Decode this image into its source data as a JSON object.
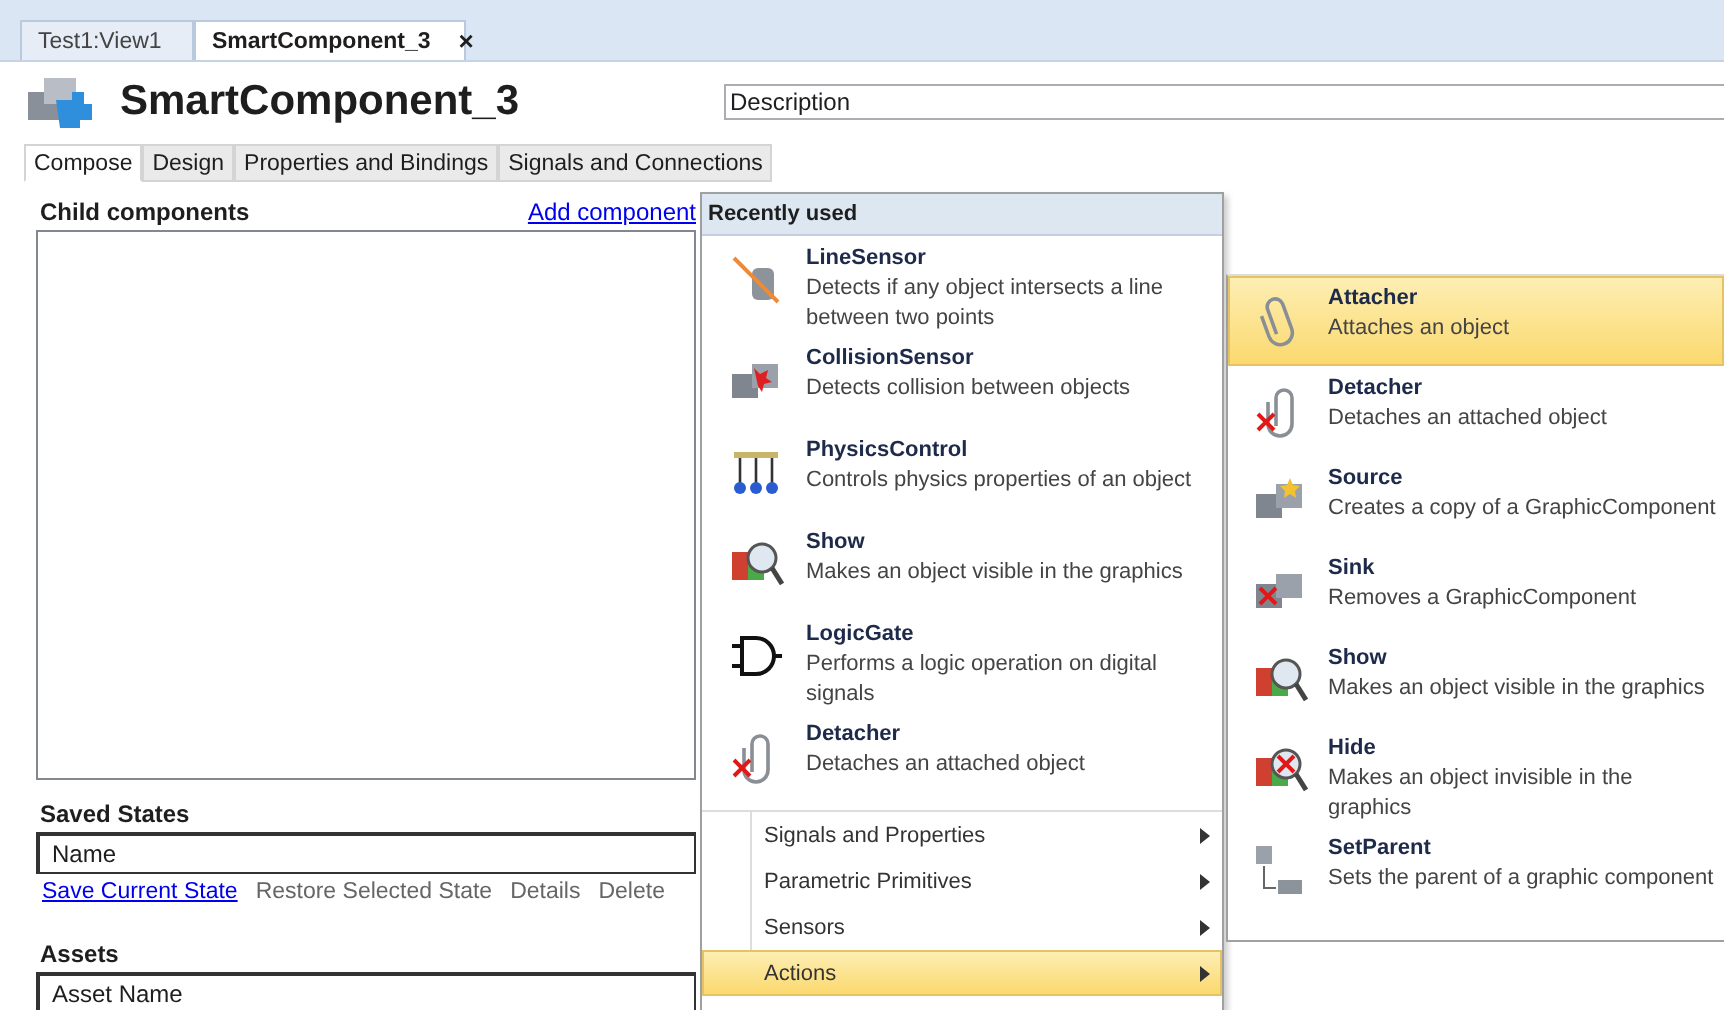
{
  "document_tabs": [
    {
      "label": "Test1:View1",
      "selected": false
    },
    {
      "label": "SmartComponent_3",
      "selected": true,
      "close": "×"
    }
  ],
  "header": {
    "title": "SmartComponent_3",
    "description": {
      "value": "Description"
    }
  },
  "tabs": [
    {
      "label": "Compose",
      "selected": true
    },
    {
      "label": "Design",
      "selected": false
    },
    {
      "label": "Properties and Bindings",
      "selected": false
    },
    {
      "label": "Signals and Connections",
      "selected": false
    }
  ],
  "child_components": {
    "label": "Child components",
    "add_link": "Add component"
  },
  "saved_states": {
    "label": "Saved States",
    "column": "Name",
    "actions": [
      {
        "label": "Save Current State",
        "disabled": false
      },
      {
        "label": "Restore Selected State",
        "disabled": true
      },
      {
        "label": "Details",
        "disabled": true
      },
      {
        "label": "Delete",
        "disabled": true
      }
    ]
  },
  "assets": {
    "label": "Assets",
    "column": "Asset Name"
  },
  "recent_menu": {
    "header": "Recently used",
    "items": [
      {
        "title": "LineSensor",
        "description": "Detects if any object intersects a line\nbetween two points"
      },
      {
        "title": "CollisionSensor",
        "description": "Detects collision between objects"
      },
      {
        "title": "PhysicsControl",
        "description": "Controls physics properties of an object"
      },
      {
        "title": "Show",
        "description": "Makes an object visible in the graphics"
      },
      {
        "title": "LogicGate",
        "description": "Performs a logic operation on digital\nsignals"
      },
      {
        "title": "Detacher",
        "description": "Detaches an attached object"
      }
    ],
    "submenus": [
      {
        "label": "Signals and Properties",
        "selected": false
      },
      {
        "label": "Parametric Primitives",
        "selected": false
      },
      {
        "label": "Sensors",
        "selected": false
      },
      {
        "label": "Actions",
        "selected": true
      }
    ]
  },
  "actions_menu": {
    "items": [
      {
        "title": "Attacher",
        "description": "Attaches an object",
        "selected": true
      },
      {
        "title": "Detacher",
        "description": "Detaches an attached object",
        "selected": false
      },
      {
        "title": "Source",
        "description": "Creates a copy of a GraphicComponent",
        "selected": false
      },
      {
        "title": "Sink",
        "description": "Removes a GraphicComponent",
        "selected": false
      },
      {
        "title": "Show",
        "description": "Makes an object visible in the graphics",
        "selected": false
      },
      {
        "title": "Hide",
        "description": "Makes an object invisible in the\ngraphics",
        "selected": false
      },
      {
        "title": "SetParent",
        "description": "Sets the parent of a graphic component",
        "selected": false
      }
    ]
  }
}
